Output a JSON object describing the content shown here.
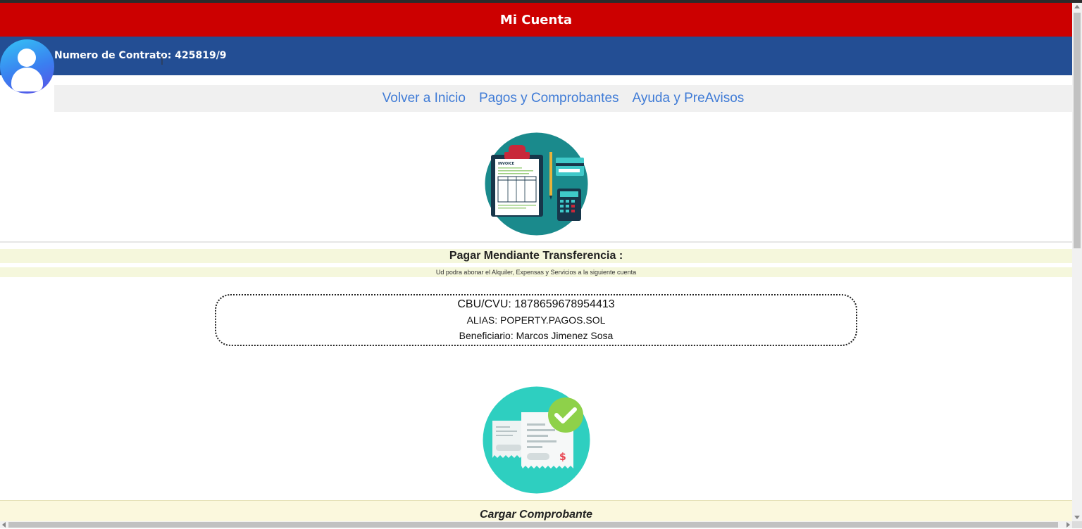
{
  "header": {
    "title": "Mi Cuenta",
    "contract_label": "Numero de Contrato: 425819/9"
  },
  "nav": {
    "items": [
      {
        "label": "Volver a Inicio"
      },
      {
        "label": "Pagos y Comprobantes"
      },
      {
        "label": "Ayuda y PreAvisos"
      }
    ]
  },
  "invoice_illustration": {
    "icon": "invoice-illustration-icon",
    "text": "INVOICE"
  },
  "transfer": {
    "title": "Pagar Mendiante Transferencia :",
    "subtitle": "Ud podra abonar el Alquiler, Expensas y Servicios a la siguiente cuenta",
    "cbu": "CBU/CVU: 1878659678954413",
    "alias": "ALIAS: POPERTY.PAGOS.SOL",
    "beneficiary": "Beneficiario: Marcos Jimenez Sosa"
  },
  "receipt_illustration": {
    "icon": "receipt-check-icon",
    "symbol": "$"
  },
  "upload": {
    "title": "Cargar Comprobante"
  },
  "colors": {
    "title_bar": "#cc0000",
    "contract_bar": "#234e94",
    "nav_link": "#3f7bd6",
    "section_bg": "#f5f7dc"
  }
}
